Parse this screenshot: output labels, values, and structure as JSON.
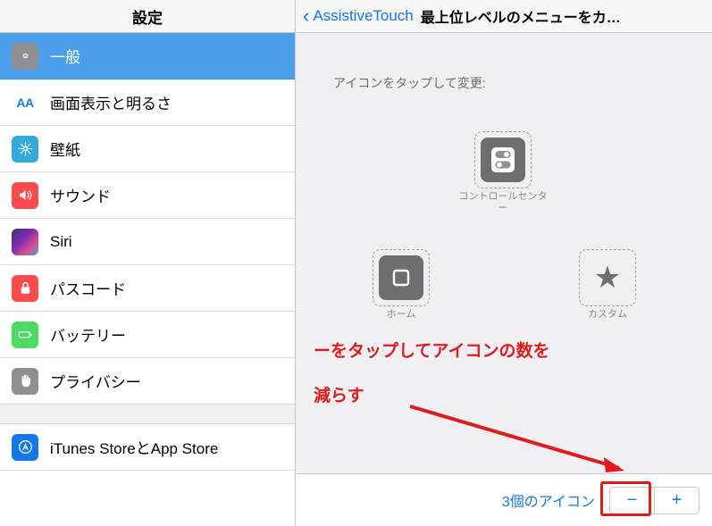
{
  "left_pane": {
    "header_title": "設定",
    "items": [
      {
        "label": "一般",
        "icon": "gear-icon",
        "icon_class": "ic-general",
        "selected": true
      },
      {
        "label": "画面表示と明るさ",
        "icon": "display-brightness-icon",
        "icon_class": "ic-display",
        "selected": false
      },
      {
        "label": "壁紙",
        "icon": "wallpaper-flower-icon",
        "icon_class": "ic-wallpaper",
        "selected": false
      },
      {
        "label": "サウンド",
        "icon": "speaker-icon",
        "icon_class": "ic-sound",
        "selected": false
      },
      {
        "label": "Siri",
        "icon": "siri-icon",
        "icon_class": "ic-siri",
        "selected": false
      },
      {
        "label": "パスコード",
        "icon": "lock-icon",
        "icon_class": "ic-passcode",
        "selected": false
      },
      {
        "label": "バッテリー",
        "icon": "battery-icon",
        "icon_class": "ic-battery",
        "selected": false
      },
      {
        "label": "プライバシー",
        "icon": "hand-icon",
        "icon_class": "ic-privacy",
        "selected": false
      },
      {
        "label": "iTunes StoreとApp Store",
        "icon": "app-store-icon",
        "icon_class": "ic-itunes",
        "selected": false
      }
    ]
  },
  "right_pane": {
    "back_label": "AssistiveTouch",
    "back_icon": "chevron-left-icon",
    "title": "最上位レベルのメニューをカ…",
    "instruction": "アイコンをタップして変更:",
    "icons": [
      {
        "label": "コントロールセンター",
        "glyph": "control-center-icon",
        "position": "top-center"
      },
      {
        "label": "ホーム",
        "glyph": "home-square-icon",
        "position": "bottom-left"
      },
      {
        "label": "カスタム",
        "glyph": "star-icon",
        "position": "bottom-right"
      }
    ],
    "annotation": {
      "line1": "ーをタップしてアイコンの数を",
      "line2": "減らす",
      "color": "#e01b1b",
      "arrow": "red-arrow-pointing-to-minus"
    },
    "footer": {
      "count_label": "3個のアイコン",
      "minus_label": "−",
      "plus_label": "+",
      "highlight_color": "#e01b1b"
    }
  }
}
